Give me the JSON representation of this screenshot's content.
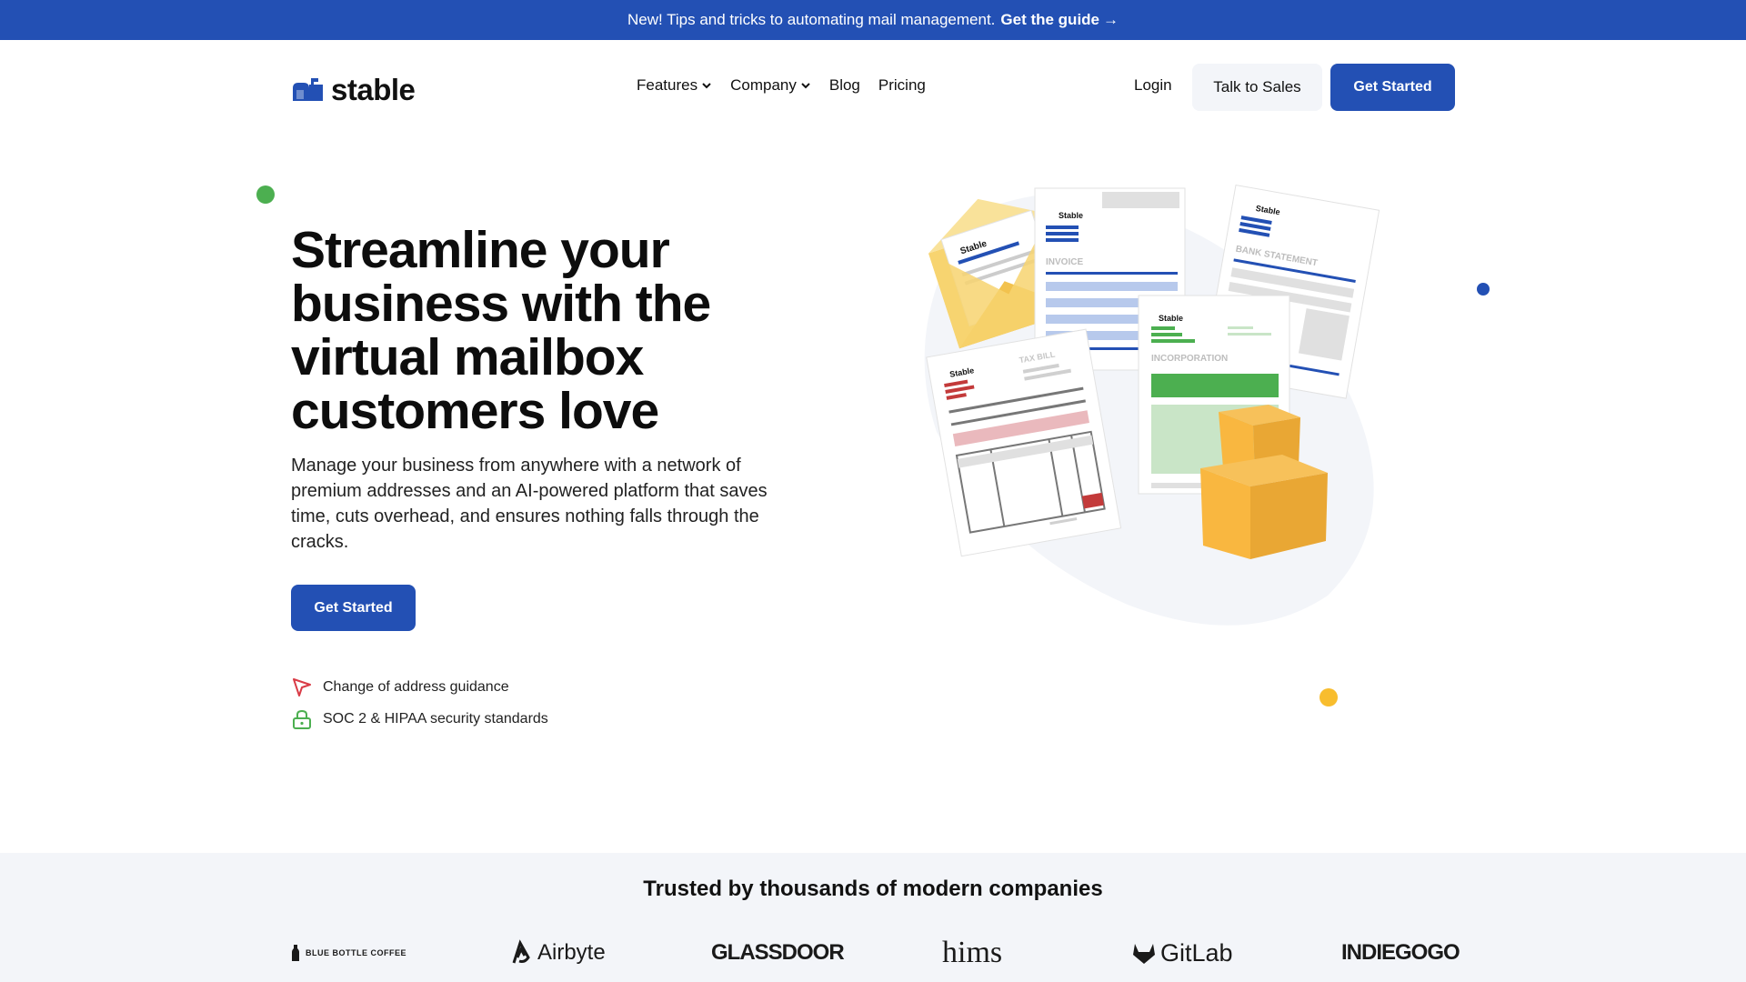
{
  "announcement": {
    "text": "New! Tips and tricks to automating mail management.",
    "link": "Get the guide",
    "arrow": "→"
  },
  "nav": {
    "logo_text": "stable",
    "logo_icon": "mailbox-icon",
    "menu": [
      {
        "label": "Features",
        "has_dropdown": true
      },
      {
        "label": "Company",
        "has_dropdown": true
      },
      {
        "label": "Blog",
        "has_dropdown": false
      },
      {
        "label": "Pricing",
        "has_dropdown": false
      }
    ],
    "login": "Login",
    "talk_to_sales": "Talk to Sales",
    "get_started": "Get Started"
  },
  "hero": {
    "title_lines": [
      "Streamline your",
      "business with the",
      "virtual mailbox",
      "customers love"
    ],
    "description": "Manage your business from anywhere with a network of premium addresses and an AI-powered platform that saves time, cuts overhead, and ensures nothing falls through the cracks.",
    "cta": "Get Started",
    "features": [
      {
        "icon": "send-arrow-icon",
        "text": "Change of address guidance"
      },
      {
        "icon": "lock-icon",
        "text": "SOC 2 & HIPAA security standards"
      }
    ]
  },
  "illustration": {
    "brand": "Stable",
    "documents": [
      "INVOICE",
      "BANK STATEMENT",
      "TAX BILL",
      "INCORPORATION"
    ]
  },
  "trusted": {
    "title": "Trusted by thousands of modern companies",
    "logos": [
      "BLUE BOTTLE COFFEE",
      "Airbyte",
      "GLASSDOOR",
      "hims",
      "GitLab",
      "INDIEGOGO"
    ]
  },
  "colors": {
    "brand_blue": "#2350b4",
    "dot_green": "#4caf50",
    "dot_blue": "#2350b4",
    "dot_yellow": "#f8bd2e",
    "light_bg": "#f3f5f9"
  }
}
